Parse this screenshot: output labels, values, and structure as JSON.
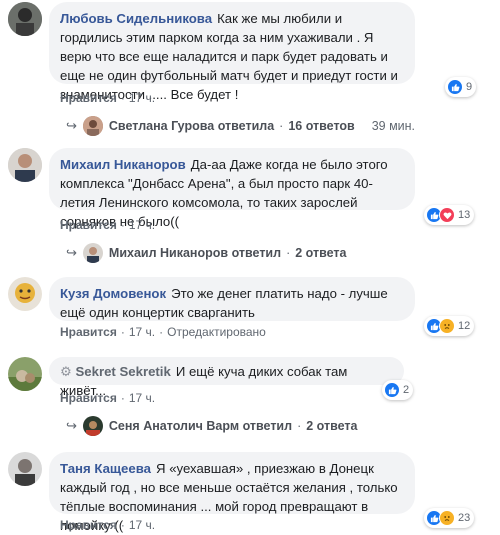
{
  "comments": [
    {
      "author": "Любовь Сидельникова",
      "text": "Как же мы любили и гордились этим парком когда за ним ухаживали . Я верю что все еще наладится и парк будет радовать и еще не один футбольный матч будет и приедут гости и знаменитости ..... Все будет !",
      "like": "Нравится",
      "time": "17 ч.",
      "reaction_count": "9",
      "reply": {
        "author": "Светлана Гурова",
        "action": "ответила",
        "count": "16 ответов",
        "time": "39 мин."
      }
    },
    {
      "author": "Михаил Никаноров",
      "text": "Да-аа Даже когда не было этого комплекса \"Донбасс Арена\", а был просто парк 40-летия Ленинского комсомола, то таких зарослей сорняков не было((",
      "like": "Нравится",
      "time": "17 ч.",
      "reaction_count": "13",
      "reply": {
        "author": "Михаил Никаноров",
        "action": "ответил",
        "count": "2 ответа"
      }
    },
    {
      "author": "Кузя Домовенок",
      "text": "Это же денег платить надо - лучше ещё один концертик сварганить",
      "like": "Нравится",
      "time": "17 ч.",
      "edited": "Отредактировано",
      "reaction_count": "12"
    },
    {
      "author": "Sekret Sekretik",
      "text": "И ещё куча диких собак там живёт...",
      "like": "Нравится",
      "time": "17 ч.",
      "reaction_count": "2",
      "reply": {
        "author": "Сеня Анатолич Варм",
        "action": "ответил",
        "count": "2 ответа"
      }
    },
    {
      "author": "Таня Кащеева",
      "text": "Я «уехавшая» , приезжаю в Донецк каждый год , но все меньше остаётся желания , только тёплые воспоминания ... мой город превращают в помойку ((",
      "like": "Нравится",
      "time": "17 ч.",
      "reaction_count": "23"
    }
  ],
  "colors": {
    "author": "#385898",
    "bubble": "#f2f3f5",
    "meta": "#606770",
    "like_icon": "#1877f2",
    "love_icon": "#f33e58",
    "sad_icon": "#f7b125"
  },
  "icons": {
    "reply_arrow": "↪",
    "dot": "·"
  }
}
